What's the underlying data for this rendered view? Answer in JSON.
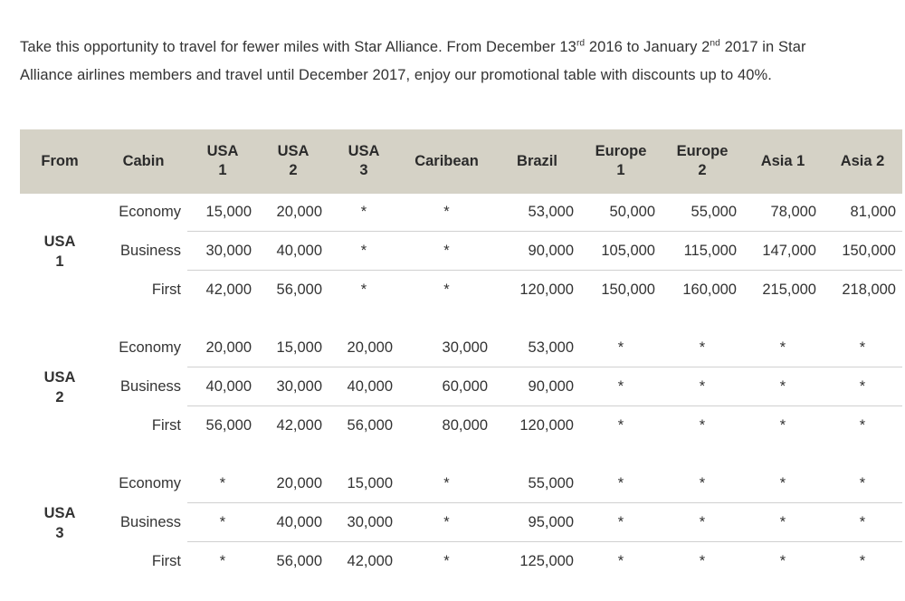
{
  "intro": {
    "part1": "Take this opportunity to travel for fewer miles with Star Alliance. From December 13",
    "sup1": "rd",
    "part2": " 2016 to January 2",
    "sup2": "nd",
    "part3": " 2017 in Star Alliance airlines members and travel until December 2017, enjoy our promotional table with discounts up to 40%."
  },
  "table": {
    "colors": {
      "header_bg": "#d5d2c6",
      "header_text": "#2b2b2b",
      "body_text": "#333333",
      "rule": "#d0d0d0",
      "block_rule": "#cfcfcf"
    },
    "headers": [
      {
        "line1": "From",
        "line2": ""
      },
      {
        "line1": "Cabin",
        "line2": ""
      },
      {
        "line1": "USA",
        "line2": "1"
      },
      {
        "line1": "USA",
        "line2": "2"
      },
      {
        "line1": "USA",
        "line2": "3"
      },
      {
        "line1": "Caribean",
        "line2": ""
      },
      {
        "line1": "Brazil",
        "line2": ""
      },
      {
        "line1": "Europe",
        "line2": "1"
      },
      {
        "line1": "Europe",
        "line2": "2"
      },
      {
        "line1": "Asia 1",
        "line2": ""
      },
      {
        "line1": "Asia 2",
        "line2": ""
      }
    ],
    "groups": [
      {
        "from": "USA",
        "from_num": "1",
        "rows": [
          {
            "cabin": "Economy",
            "values": [
              "15,000",
              "20,000",
              "*",
              "*",
              "53,000",
              "50,000",
              "55,000",
              "78,000",
              "81,000"
            ]
          },
          {
            "cabin": "Business",
            "values": [
              "30,000",
              "40,000",
              "*",
              "*",
              "90,000",
              "105,000",
              "115,000",
              "147,000",
              "150,000"
            ]
          },
          {
            "cabin": "First",
            "values": [
              "42,000",
              "56,000",
              "*",
              "*",
              "120,000",
              "150,000",
              "160,000",
              "215,000",
              "218,000"
            ]
          }
        ]
      },
      {
        "from": "USA",
        "from_num": "2",
        "rows": [
          {
            "cabin": "Economy",
            "values": [
              "20,000",
              "15,000",
              "20,000",
              "30,000",
              "53,000",
              "*",
              "*",
              "*",
              "*"
            ]
          },
          {
            "cabin": "Business",
            "values": [
              "40,000",
              "30,000",
              "40,000",
              "60,000",
              "90,000",
              "*",
              "*",
              "*",
              "*"
            ]
          },
          {
            "cabin": "First",
            "values": [
              "56,000",
              "42,000",
              "56,000",
              "80,000",
              "120,000",
              "*",
              "*",
              "*",
              "*"
            ]
          }
        ]
      },
      {
        "from": "USA",
        "from_num": "3",
        "rows": [
          {
            "cabin": "Economy",
            "values": [
              "*",
              "20,000",
              "15,000",
              "*",
              "55,000",
              "*",
              "*",
              "*",
              "*"
            ]
          },
          {
            "cabin": "Business",
            "values": [
              "*",
              "40,000",
              "30,000",
              "*",
              "95,000",
              "*",
              "*",
              "*",
              "*"
            ]
          },
          {
            "cabin": "First",
            "values": [
              "*",
              "56,000",
              "42,000",
              "*",
              "125,000",
              "*",
              "*",
              "*",
              "*"
            ]
          }
        ]
      }
    ]
  }
}
